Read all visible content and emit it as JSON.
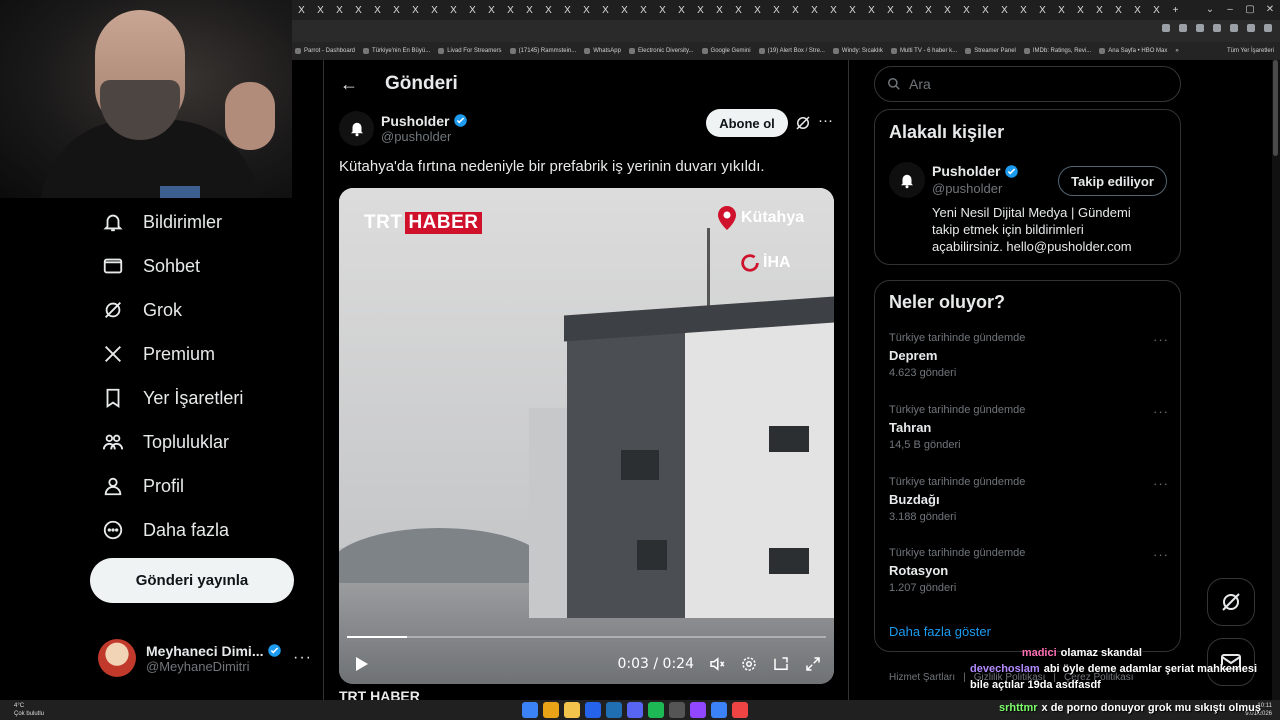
{
  "browser": {
    "tab_glyph": "X",
    "new_tab": "+",
    "window_controls": [
      "⌄",
      "–",
      "▢",
      "✕"
    ],
    "bookmarks": [
      "Parrot - Dashboard",
      "Türkiye'nin En Büyü...",
      "Livad For Streamers",
      "(17145) Rammstein...",
      "WhatsApp",
      "Electronic Diversity...",
      "Google Gemini",
      "(19) Alert Box / Stre...",
      "Windy: Sıcaklık",
      "Multi TV - 6 haber k...",
      "Streamer Panel",
      "IMDb: Ratings, Revi...",
      "Ana Sayfa • HBO Max"
    ],
    "bookmarks_overflow": "»",
    "bookmarks_all": "Tüm Yer İşaretleri"
  },
  "nav": {
    "items": [
      {
        "label": "Bildirimler",
        "icon": "bell-icon"
      },
      {
        "label": "Sohbet",
        "icon": "envelope-icon"
      },
      {
        "label": "Grok",
        "icon": "grok-icon"
      },
      {
        "label": "Premium",
        "icon": "x-logo-icon"
      },
      {
        "label": "Yer İşaretleri",
        "icon": "bookmark-icon"
      },
      {
        "label": "Topluluklar",
        "icon": "communities-icon"
      },
      {
        "label": "Profil",
        "icon": "person-icon"
      },
      {
        "label": "Daha fazla",
        "icon": "more-circle-icon"
      }
    ],
    "post_button": "Gönderi yayınla",
    "account": {
      "name": "Meyhaneci Dimi...",
      "handle": "@MeyhaneDimitri",
      "more": "···"
    }
  },
  "post": {
    "header_title": "Gönderi",
    "back": "←",
    "author_name": "Pusholder",
    "author_handle": "@pusholder",
    "subscribe_label": "Abone ol",
    "more": "···",
    "text": "Kütahya'da fırtına nedeniyle bir prefabrik iş yerinin duvarı yıkıldı.",
    "video": {
      "brand_trt": "TRT",
      "brand_haber": "HABER",
      "location": "Kütahya",
      "agency": "İHA",
      "time": "0:03 / 0:24",
      "progress": 0.125
    },
    "next_post_preview": "TRT HABER"
  },
  "search": {
    "placeholder": "Ara"
  },
  "related": {
    "title": "Alakalı kişiler",
    "name": "Pusholder",
    "handle": "@pusholder",
    "follow_label": "Takip ediliyor",
    "bio": "Yeni Nesil Dijital Medya | Gündemi takip etmek için bildirimleri açabilirsiniz. hello@pusholder.com"
  },
  "trends": {
    "title": "Neler oluyor?",
    "items": [
      {
        "context": "Türkiye tarihinde gündemde",
        "title": "Deprem",
        "count": "4.623 gönderi"
      },
      {
        "context": "Türkiye tarihinde gündemde",
        "title": "Tahran",
        "count": "14,5 B gönderi"
      },
      {
        "context": "Türkiye tarihinde gündemde",
        "title": "Buzdağı",
        "count": "3.188 gönderi"
      },
      {
        "context": "Türkiye tarihinde gündemde",
        "title": "Rotasyon",
        "count": "1.207 gönderi"
      }
    ],
    "more_glyph": "···",
    "show_more": "Daha fazla göster"
  },
  "footer": {
    "terms": "Hizmet Şartları",
    "sep": "|",
    "privacy": "Gizlilik Politikası",
    "cookies": "Çerez Politikası"
  },
  "chat": [
    {
      "user": "madici",
      "color": "#ff6fb5",
      "text": "olamaz skandal"
    },
    {
      "user": "devechoslam",
      "color": "#b38bff",
      "text": "abi öyle deme adamlar şeriat mahkemesi bile açtılar 19da asdfasdf"
    },
    {
      "user": "srhttmr",
      "color": "#7dff6b",
      "text": "x de porno donuyor grok mu sıkıştı olmuş"
    }
  ],
  "taskbar": {
    "weather_temp": "4°C",
    "weather_desc": "Çok bulutlu",
    "clock_time": "10:11",
    "clock_date": "9.01.2026"
  },
  "colors": {
    "accent": "#1d9bf0",
    "verified": "#1d9bf0",
    "trt_red": "#d0112b"
  }
}
